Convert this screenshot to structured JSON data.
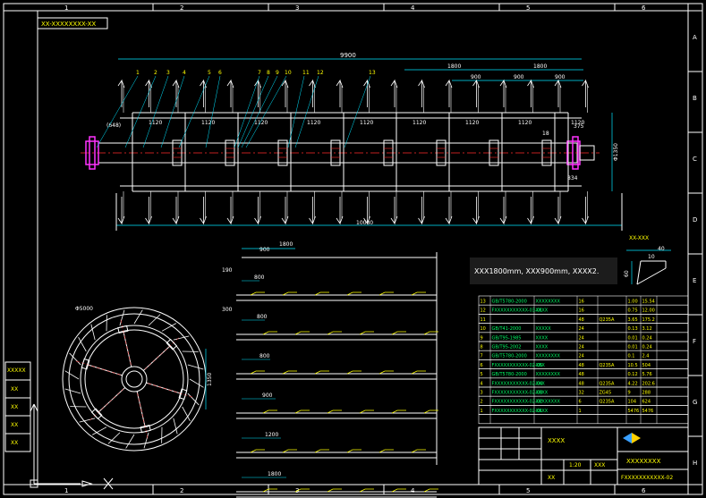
{
  "colors": {
    "background": "#000000",
    "frame": "#ffffff",
    "dimension": "#00e5ff",
    "centerline": "#ff2a2a",
    "flange": "#ff33ff",
    "text_yellow": "#ffff00",
    "table": "#00ff66",
    "note": "#ffffff"
  },
  "border": {
    "columns": [
      "1",
      "2",
      "3",
      "4",
      "5",
      "6"
    ],
    "rows": [
      "A",
      "B",
      "C",
      "D",
      "E",
      "F",
      "G",
      "H"
    ]
  },
  "drawing_id_box": "XX-XXXXXXXX-XX",
  "top_view": {
    "overall_length": "9900",
    "pitch_labels": [
      "1120",
      "1120",
      "1120",
      "1120",
      "1120",
      "1120",
      "1120",
      "1120",
      "1120"
    ],
    "left_offset": "(648)",
    "right_dim_1": "375",
    "right_dim_2": "18",
    "upper_dims": [
      "1800",
      "1800",
      "900",
      "900",
      "900"
    ],
    "diameter_label": "Φ1350",
    "lower_dim": "834",
    "bottom_label": "10080",
    "balloons": [
      "1",
      "2",
      "3",
      "4",
      "5",
      "6",
      "7",
      "8",
      "9",
      "10",
      "11",
      "12",
      "13"
    ]
  },
  "side_view": {
    "diameter_label": "Φ5000",
    "inner_label": "1350"
  },
  "development_view": {
    "top_dims": [
      "1800",
      "900"
    ],
    "rows": [
      {
        "left": "190",
        "mid": "800"
      },
      {
        "left": "300",
        "mid": "800"
      },
      {
        "left": "",
        "mid": "800"
      },
      {
        "left": "",
        "mid": "900"
      },
      {
        "left": "",
        "mid": "1200"
      },
      {
        "left": "",
        "mid": "1800"
      }
    ]
  },
  "detail_view": {
    "title": "XX-XXX",
    "dim_a": "40",
    "dim_b": "10",
    "dim_c": "60"
  },
  "note_text": "XXX1800mm, XXX900mm, XXXX2.",
  "bom": {
    "rows": [
      [
        "13",
        "GB/T5780-2000",
        "XXXXXXXX",
        "16",
        "",
        "1.00",
        "15.54"
      ],
      [
        "12",
        "FXXXXXXXXXXX-03-01",
        "XXXX",
        "16",
        "",
        "0.75",
        "12.00"
      ],
      [
        "11",
        "",
        "",
        "48",
        "Q235A",
        "3.65",
        "175.2"
      ],
      [
        "10",
        "GB/T41-2000",
        "XXXXX",
        "24",
        "",
        "0.13",
        "3.12"
      ],
      [
        "9",
        "GB/T95-1985",
        "XXXX",
        "24",
        "",
        "0.01",
        "0.24"
      ],
      [
        "8",
        "GB/T95-2002",
        "XXXX",
        "24",
        "",
        "0.01",
        "0.24"
      ],
      [
        "7",
        "GB/T5780-2000",
        "XXXXXXXX",
        "24",
        "",
        "0.1",
        "2.4"
      ],
      [
        "6",
        "FXXXXXXXXXXX-02-05",
        "XXX",
        "48",
        "Q235A",
        "10.5",
        "504"
      ],
      [
        "5",
        "GB/T5780-2000",
        "XXXXXXXX",
        "48",
        "",
        "0.12",
        "5.76"
      ],
      [
        "4",
        "FXXXXXXXXXXX-02-04",
        "XXX",
        "48",
        "Q235A",
        "4.22",
        "202.6"
      ],
      [
        "3",
        "FXXXXXXXXXXX-02-03",
        "XXXX",
        "32",
        "ZG45",
        "9",
        "288"
      ],
      [
        "2",
        "FXXXXXXXXXXX-02-02",
        "XXXXXXXX",
        "6",
        "Q235A",
        "104",
        "624"
      ],
      [
        "1",
        "FXXXXXXXXXXX-02-01",
        "XXXX",
        "1",
        "",
        "5476",
        "5476"
      ]
    ],
    "header": [
      "",
      "",
      "",
      "",
      "",
      "",
      ""
    ]
  },
  "title_block": {
    "title": "XXXXXXXX",
    "drawing_number": "FXXXXXXXXXXX-02",
    "assembly": "XXXX",
    "scale": "1:20",
    "weight": "XXX",
    "sheet": "XX"
  },
  "left_panel_labels": [
    "XXXXX",
    "XX",
    "XX",
    "XX",
    "XX"
  ]
}
